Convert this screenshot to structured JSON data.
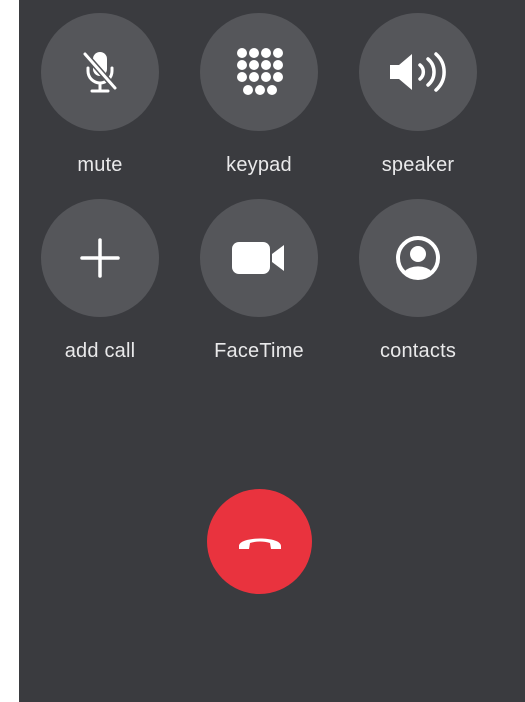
{
  "controls": {
    "mute": {
      "label": "mute",
      "icon": "mic-slash-icon"
    },
    "keypad": {
      "label": "keypad",
      "icon": "keypad-grid-icon"
    },
    "speaker": {
      "label": "speaker",
      "icon": "speaker-wave-icon"
    },
    "add_call": {
      "label": "add call",
      "icon": "plus-icon"
    },
    "facetime": {
      "label": "FaceTime",
      "icon": "video-camera-icon"
    },
    "contacts": {
      "label": "contacts",
      "icon": "person-circle-icon"
    }
  },
  "end_call": {
    "icon": "phone-down-icon",
    "color": "#e9333e"
  },
  "colors": {
    "background": "#3a3b3f",
    "button": "#55565a",
    "label": "#e9e9ea",
    "end_call": "#e9333e"
  }
}
